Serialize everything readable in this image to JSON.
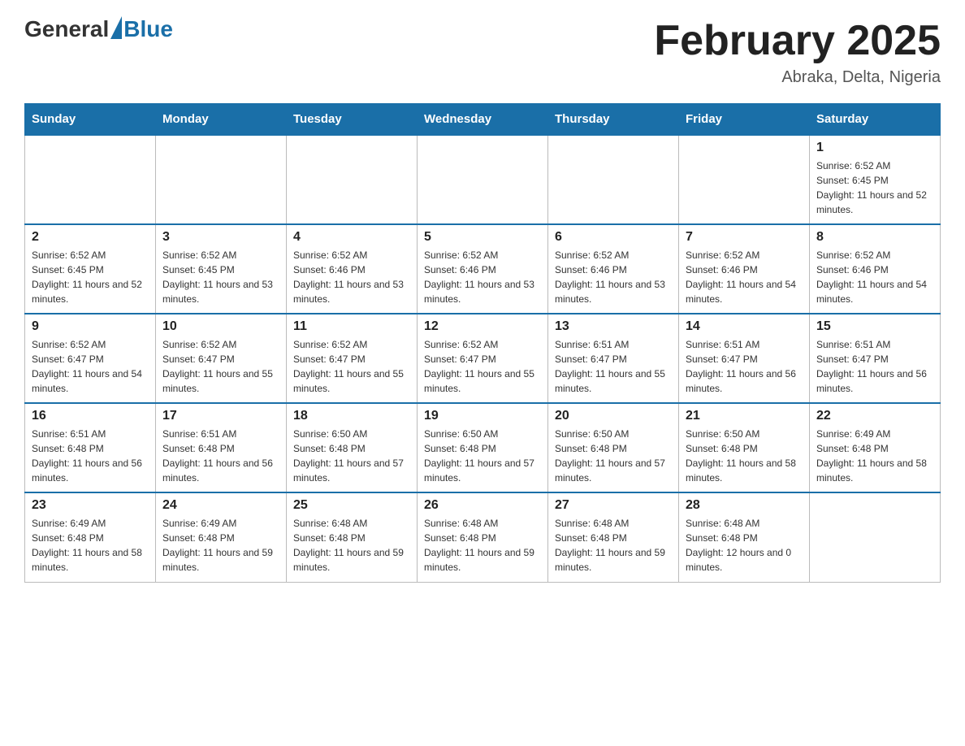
{
  "logo": {
    "text_general": "General",
    "text_blue": "Blue"
  },
  "header": {
    "month_year": "February 2025",
    "location": "Abraka, Delta, Nigeria"
  },
  "weekdays": [
    "Sunday",
    "Monday",
    "Tuesday",
    "Wednesday",
    "Thursday",
    "Friday",
    "Saturday"
  ],
  "weeks": [
    [
      {
        "day": "",
        "sunrise": "",
        "sunset": "",
        "daylight": "",
        "empty": true
      },
      {
        "day": "",
        "sunrise": "",
        "sunset": "",
        "daylight": "",
        "empty": true
      },
      {
        "day": "",
        "sunrise": "",
        "sunset": "",
        "daylight": "",
        "empty": true
      },
      {
        "day": "",
        "sunrise": "",
        "sunset": "",
        "daylight": "",
        "empty": true
      },
      {
        "day": "",
        "sunrise": "",
        "sunset": "",
        "daylight": "",
        "empty": true
      },
      {
        "day": "",
        "sunrise": "",
        "sunset": "",
        "daylight": "",
        "empty": true
      },
      {
        "day": "1",
        "sunrise": "Sunrise: 6:52 AM",
        "sunset": "Sunset: 6:45 PM",
        "daylight": "Daylight: 11 hours and 52 minutes.",
        "empty": false
      }
    ],
    [
      {
        "day": "2",
        "sunrise": "Sunrise: 6:52 AM",
        "sunset": "Sunset: 6:45 PM",
        "daylight": "Daylight: 11 hours and 52 minutes.",
        "empty": false
      },
      {
        "day": "3",
        "sunrise": "Sunrise: 6:52 AM",
        "sunset": "Sunset: 6:45 PM",
        "daylight": "Daylight: 11 hours and 53 minutes.",
        "empty": false
      },
      {
        "day": "4",
        "sunrise": "Sunrise: 6:52 AM",
        "sunset": "Sunset: 6:46 PM",
        "daylight": "Daylight: 11 hours and 53 minutes.",
        "empty": false
      },
      {
        "day": "5",
        "sunrise": "Sunrise: 6:52 AM",
        "sunset": "Sunset: 6:46 PM",
        "daylight": "Daylight: 11 hours and 53 minutes.",
        "empty": false
      },
      {
        "day": "6",
        "sunrise": "Sunrise: 6:52 AM",
        "sunset": "Sunset: 6:46 PM",
        "daylight": "Daylight: 11 hours and 53 minutes.",
        "empty": false
      },
      {
        "day": "7",
        "sunrise": "Sunrise: 6:52 AM",
        "sunset": "Sunset: 6:46 PM",
        "daylight": "Daylight: 11 hours and 54 minutes.",
        "empty": false
      },
      {
        "day": "8",
        "sunrise": "Sunrise: 6:52 AM",
        "sunset": "Sunset: 6:46 PM",
        "daylight": "Daylight: 11 hours and 54 minutes.",
        "empty": false
      }
    ],
    [
      {
        "day": "9",
        "sunrise": "Sunrise: 6:52 AM",
        "sunset": "Sunset: 6:47 PM",
        "daylight": "Daylight: 11 hours and 54 minutes.",
        "empty": false
      },
      {
        "day": "10",
        "sunrise": "Sunrise: 6:52 AM",
        "sunset": "Sunset: 6:47 PM",
        "daylight": "Daylight: 11 hours and 55 minutes.",
        "empty": false
      },
      {
        "day": "11",
        "sunrise": "Sunrise: 6:52 AM",
        "sunset": "Sunset: 6:47 PM",
        "daylight": "Daylight: 11 hours and 55 minutes.",
        "empty": false
      },
      {
        "day": "12",
        "sunrise": "Sunrise: 6:52 AM",
        "sunset": "Sunset: 6:47 PM",
        "daylight": "Daylight: 11 hours and 55 minutes.",
        "empty": false
      },
      {
        "day": "13",
        "sunrise": "Sunrise: 6:51 AM",
        "sunset": "Sunset: 6:47 PM",
        "daylight": "Daylight: 11 hours and 55 minutes.",
        "empty": false
      },
      {
        "day": "14",
        "sunrise": "Sunrise: 6:51 AM",
        "sunset": "Sunset: 6:47 PM",
        "daylight": "Daylight: 11 hours and 56 minutes.",
        "empty": false
      },
      {
        "day": "15",
        "sunrise": "Sunrise: 6:51 AM",
        "sunset": "Sunset: 6:47 PM",
        "daylight": "Daylight: 11 hours and 56 minutes.",
        "empty": false
      }
    ],
    [
      {
        "day": "16",
        "sunrise": "Sunrise: 6:51 AM",
        "sunset": "Sunset: 6:48 PM",
        "daylight": "Daylight: 11 hours and 56 minutes.",
        "empty": false
      },
      {
        "day": "17",
        "sunrise": "Sunrise: 6:51 AM",
        "sunset": "Sunset: 6:48 PM",
        "daylight": "Daylight: 11 hours and 56 minutes.",
        "empty": false
      },
      {
        "day": "18",
        "sunrise": "Sunrise: 6:50 AM",
        "sunset": "Sunset: 6:48 PM",
        "daylight": "Daylight: 11 hours and 57 minutes.",
        "empty": false
      },
      {
        "day": "19",
        "sunrise": "Sunrise: 6:50 AM",
        "sunset": "Sunset: 6:48 PM",
        "daylight": "Daylight: 11 hours and 57 minutes.",
        "empty": false
      },
      {
        "day": "20",
        "sunrise": "Sunrise: 6:50 AM",
        "sunset": "Sunset: 6:48 PM",
        "daylight": "Daylight: 11 hours and 57 minutes.",
        "empty": false
      },
      {
        "day": "21",
        "sunrise": "Sunrise: 6:50 AM",
        "sunset": "Sunset: 6:48 PM",
        "daylight": "Daylight: 11 hours and 58 minutes.",
        "empty": false
      },
      {
        "day": "22",
        "sunrise": "Sunrise: 6:49 AM",
        "sunset": "Sunset: 6:48 PM",
        "daylight": "Daylight: 11 hours and 58 minutes.",
        "empty": false
      }
    ],
    [
      {
        "day": "23",
        "sunrise": "Sunrise: 6:49 AM",
        "sunset": "Sunset: 6:48 PM",
        "daylight": "Daylight: 11 hours and 58 minutes.",
        "empty": false
      },
      {
        "day": "24",
        "sunrise": "Sunrise: 6:49 AM",
        "sunset": "Sunset: 6:48 PM",
        "daylight": "Daylight: 11 hours and 59 minutes.",
        "empty": false
      },
      {
        "day": "25",
        "sunrise": "Sunrise: 6:48 AM",
        "sunset": "Sunset: 6:48 PM",
        "daylight": "Daylight: 11 hours and 59 minutes.",
        "empty": false
      },
      {
        "day": "26",
        "sunrise": "Sunrise: 6:48 AM",
        "sunset": "Sunset: 6:48 PM",
        "daylight": "Daylight: 11 hours and 59 minutes.",
        "empty": false
      },
      {
        "day": "27",
        "sunrise": "Sunrise: 6:48 AM",
        "sunset": "Sunset: 6:48 PM",
        "daylight": "Daylight: 11 hours and 59 minutes.",
        "empty": false
      },
      {
        "day": "28",
        "sunrise": "Sunrise: 6:48 AM",
        "sunset": "Sunset: 6:48 PM",
        "daylight": "Daylight: 12 hours and 0 minutes.",
        "empty": false
      },
      {
        "day": "",
        "sunrise": "",
        "sunset": "",
        "daylight": "",
        "empty": true
      }
    ]
  ]
}
